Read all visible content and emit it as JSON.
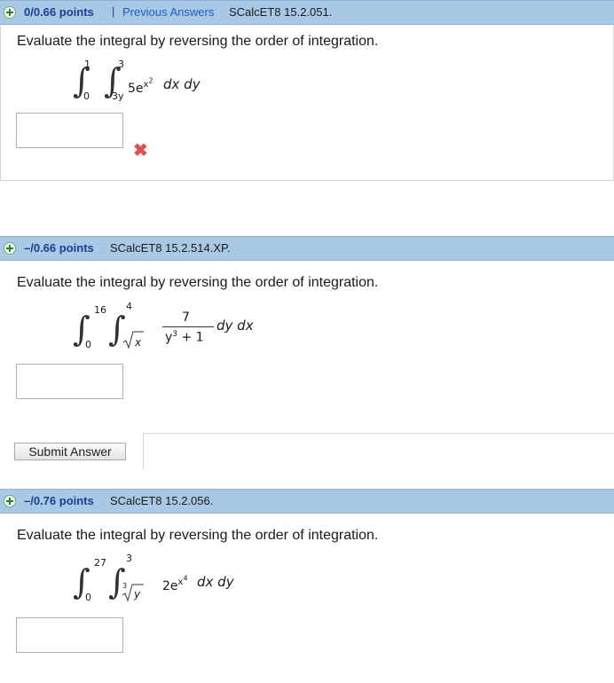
{
  "questions": [
    {
      "points": "0/0.66 points",
      "separator": "|",
      "previous_answers": "Previous Answers",
      "source": "SCalcET8 15.2.051.",
      "prompt": "Evaluate the integral by reversing the order of integration.",
      "integral": {
        "outer_upper": "1",
        "outer_lower": "0",
        "inner_upper": "3",
        "inner_lower": "3y",
        "coefficient": "5e",
        "exponent_base": "x",
        "exponent_power": "2",
        "differentials": "dx dy"
      },
      "answer_value": "",
      "status": "incorrect",
      "status_mark": "✖"
    },
    {
      "points": "–/0.66 points",
      "source": "SCalcET8 15.2.514.XP.",
      "prompt": "Evaluate the integral by reversing the order of integration.",
      "integral": {
        "outer_upper": "16",
        "outer_lower": "0",
        "inner_upper": "4",
        "inner_lower_radicand": "x",
        "numerator": "7",
        "denominator_base": "y",
        "denominator_power": "3",
        "denominator_rest": " + 1",
        "differentials": "dy dx"
      },
      "answer_value": "",
      "submit_label": "Submit Answer"
    },
    {
      "points": "–/0.76 points",
      "source": "SCalcET8 15.2.056.",
      "prompt": "Evaluate the integral by reversing the order of integration.",
      "integral": {
        "outer_upper": "27",
        "outer_lower": "0",
        "inner_upper": "3",
        "inner_lower_index": "3",
        "inner_lower_radicand": "y",
        "coefficient": "2e",
        "exponent_base": "x",
        "exponent_power": "4",
        "differentials": "dx dy"
      },
      "answer_value": ""
    }
  ],
  "colors": {
    "header_bar": "#a8c8e6",
    "points_text": "#1a3f8f",
    "link": "#1f5cc7",
    "error_mark": "#e05050"
  }
}
